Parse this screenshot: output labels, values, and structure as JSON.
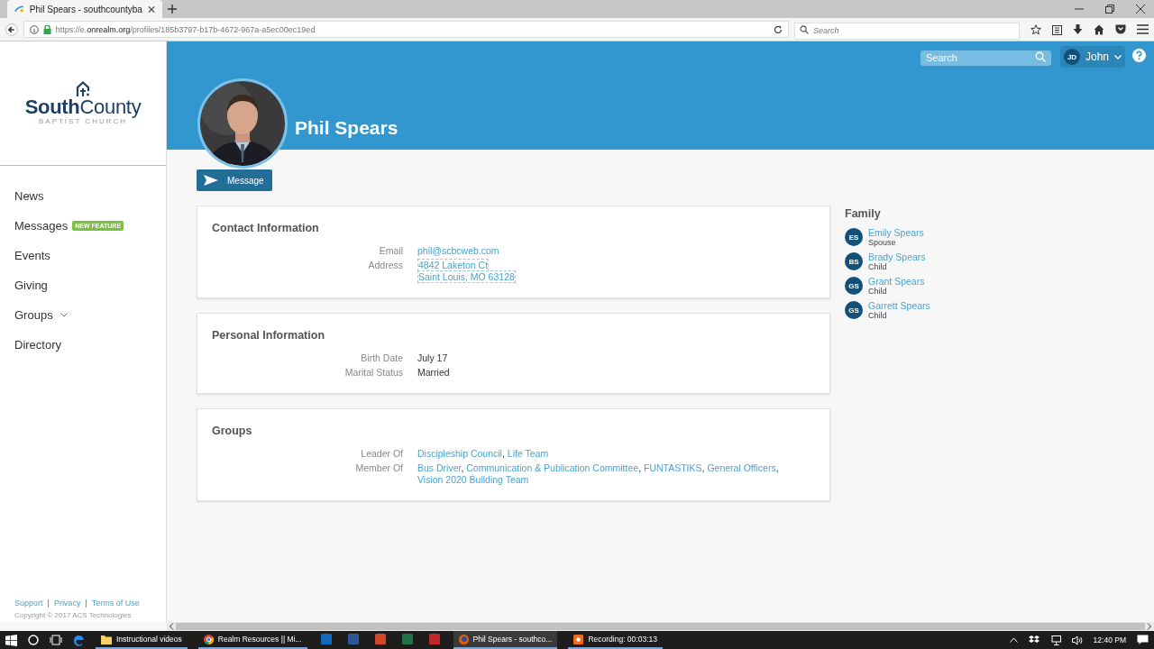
{
  "browser": {
    "tab": {
      "title": "Phil Spears - southcountyba",
      "selected": true
    },
    "address": {
      "prefix": "https://e.",
      "domain": "onrealm.org",
      "path": "/profiles/185b3797-b17b-4672-967a-a5ec00ec19ed"
    },
    "search": {
      "placeholder": "Search"
    }
  },
  "sidebar": {
    "logo": {
      "name_a": "South",
      "name_b": "County",
      "subtitle": "BAPTIST CHURCH"
    },
    "items": [
      {
        "label": "News",
        "expandable": false
      },
      {
        "label": "Messages",
        "badge": "NEW FEATURE",
        "expandable": false
      },
      {
        "label": "Events",
        "expandable": false
      },
      {
        "label": "Giving",
        "expandable": false
      },
      {
        "label": "Groups",
        "expandable": true
      },
      {
        "label": "Directory",
        "expandable": false
      }
    ],
    "footer_links": [
      "Support",
      "Privacy",
      "Terms of Use"
    ],
    "separator": "|",
    "copyright": "Copyright © 2017 ACS Technologies"
  },
  "header": {
    "search": {
      "placeholder": "Search"
    },
    "user": {
      "initials": "JD",
      "name": "John"
    }
  },
  "profile": {
    "name": "Phil Spears",
    "message_button": "Message"
  },
  "sections": [
    {
      "title": "Contact Information",
      "rows": [
        {
          "label": "Email",
          "kind": "links",
          "separator": "",
          "values": [
            "phil@scbcweb.com"
          ]
        },
        {
          "label": "Address",
          "kind": "lines",
          "separator": "",
          "values": [
            "4842 Laketon Ct",
            "Saint Louis, MO 63128"
          ]
        }
      ]
    },
    {
      "title": "Personal Information",
      "rows": [
        {
          "label": "Birth Date",
          "kind": "text",
          "separator": "",
          "values": [
            "July 17"
          ]
        },
        {
          "label": "Marital Status",
          "kind": "text",
          "separator": "",
          "values": [
            "Married"
          ]
        }
      ]
    },
    {
      "title": "Groups",
      "rows": [
        {
          "label": "Leader Of",
          "kind": "links",
          "separator": ",",
          "values": [
            "Discipleship Council",
            "Life Team"
          ]
        },
        {
          "label": "Member Of",
          "kind": "links",
          "separator": ",",
          "values": [
            "Bus Driver",
            "Communication & Publication Committee",
            "FUNTASTIKS",
            "General Officers",
            "Vision 2020 Building Team"
          ]
        }
      ]
    }
  ],
  "family": {
    "title": "Family",
    "members": [
      {
        "initials": "ES",
        "name": "Emily Spears",
        "relation": "Spouse"
      },
      {
        "initials": "BS",
        "name": "Brady Spears",
        "relation": "Child"
      },
      {
        "initials": "GS",
        "name": "Grant Spears",
        "relation": "Child"
      },
      {
        "initials": "GS",
        "name": "Garrett Spears",
        "relation": "Child"
      }
    ]
  },
  "taskbar": {
    "apps": [
      {
        "kind": "folder",
        "label": "Instructional videos",
        "selected": false
      },
      {
        "kind": "chrome",
        "label": "Realm Resources || Mi...",
        "selected": false
      },
      {
        "kind": "icon",
        "color": "#0f6cbd",
        "selected": false
      },
      {
        "kind": "icon",
        "color": "#2b579a",
        "selected": false
      },
      {
        "kind": "icon",
        "color": "#d24726",
        "selected": false
      },
      {
        "kind": "icon",
        "color": "#217346",
        "selected": false
      },
      {
        "kind": "icon",
        "color": "#c4262e",
        "selected": false
      },
      {
        "kind": "firefox",
        "label": "Phil Spears - southco...",
        "selected": true
      },
      {
        "kind": "recording",
        "label": "Recording:  00:03:13",
        "selected": false
      }
    ],
    "clock": "12:40 PM"
  }
}
